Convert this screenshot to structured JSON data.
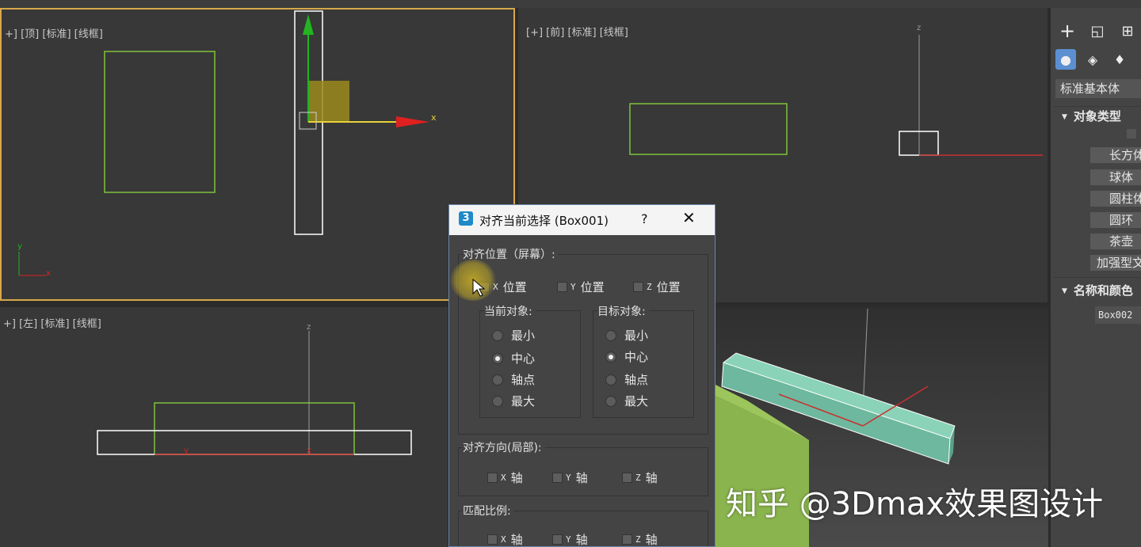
{
  "viewports": {
    "top": {
      "label": "+] [顶] [标准] [线框]"
    },
    "front": {
      "label": "[+] [前] [标准] [线框]"
    },
    "left": {
      "label": "+] [左] [标准] [线框]"
    },
    "axis_x": "x",
    "axis_y": "y",
    "axis_z": "z"
  },
  "command_panel": {
    "dropdown": "标准基本体",
    "rollout_object_type": "对象类型",
    "object_buttons": [
      "长方体",
      "球体",
      "圆柱体",
      "圆环",
      "茶壶",
      "加强型文本"
    ],
    "rollout_name_color": "名称和颜色",
    "name_value": "Box002",
    "icons": {
      "create": "plus-icon",
      "modify": "modify-icon",
      "hierarchy": "hierarchy-icon"
    }
  },
  "dialog": {
    "icon_text": "3",
    "title": "对齐当前选择 (Box001)",
    "help": "?",
    "close": "✕",
    "align_position_label": "对齐位置（屏幕）:",
    "x_pos": {
      "axis": "X",
      "label": "位置"
    },
    "y_pos": {
      "axis": "Y",
      "label": "位置"
    },
    "z_pos": {
      "axis": "Z",
      "label": "位置"
    },
    "current_object_label": "当前对象:",
    "target_object_label": "目标对象:",
    "options": [
      "最小",
      "中心",
      "轴点",
      "最大"
    ],
    "current_selected": "中心",
    "target_selected": "中心",
    "align_orientation_label": "对齐方向(局部):",
    "orient": [
      {
        "axis": "X",
        "label": "轴"
      },
      {
        "axis": "Y",
        "label": "轴"
      },
      {
        "axis": "Z",
        "label": "轴"
      }
    ],
    "match_scale_label": "匹配比例:",
    "scale": [
      {
        "axis": "X",
        "label": "轴"
      },
      {
        "axis": "Y",
        "label": "轴"
      },
      {
        "axis": "Z",
        "label": "轴"
      }
    ]
  },
  "watermark": "知乎 @3Dmax效果图设计",
  "colors": {
    "selection_white": "#ffffff",
    "object_green": "#7ec33a",
    "axis_red": "#e02020",
    "axis_green": "#22b422",
    "gizmo_yellow": "#e8d23a",
    "viewport_active_border": "#d8a84a",
    "beam_teal": "#7fcab0",
    "box_green": "#8ab44e"
  }
}
